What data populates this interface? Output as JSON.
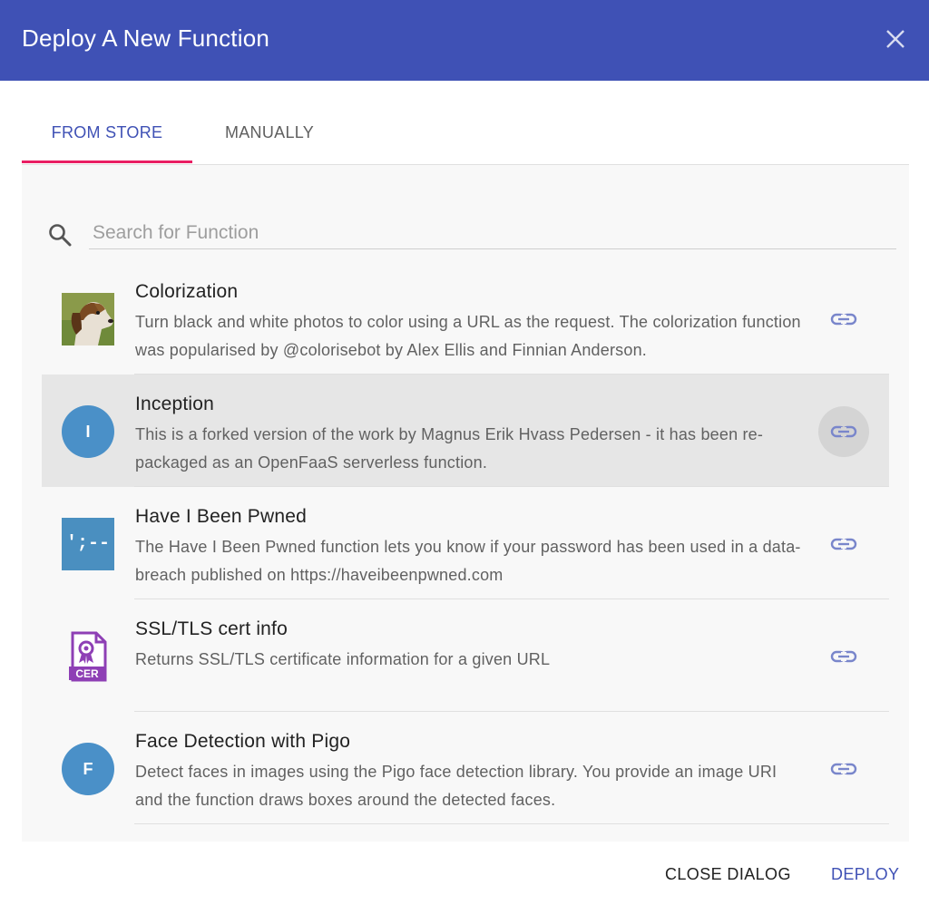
{
  "dialog": {
    "title": "Deploy A New Function",
    "close_icon": "close-icon"
  },
  "tabs": [
    {
      "label": "FROM STORE",
      "active": true
    },
    {
      "label": "MANUALLY",
      "active": false
    }
  ],
  "search": {
    "placeholder": "Search for Function",
    "value": "",
    "icon": "search-icon"
  },
  "functions": [
    {
      "name": "Colorization",
      "description": "Turn black and white photos to color using a URL as the request. The colorization function was popularised by @colorisebot by Alex Ellis and Finnian Anderson.",
      "icon": "dog-photo-icon",
      "link_icon": "link-icon"
    },
    {
      "name": "Inception",
      "description": "This is a forked version of the work by Magnus Erik Hvass Pedersen - it has been re-packaged as an OpenFaaS serverless function.",
      "icon": "letter-avatar",
      "avatar_letter": "I",
      "link_icon": "link-icon",
      "hovered": true
    },
    {
      "name": "Have I Been Pwned",
      "description": "The Have I Been Pwned function lets you know if your password has been used in a data-breach published on https://haveibeenpwned.com",
      "icon": "pwned-logo-icon",
      "logo_text": "';--",
      "link_icon": "link-icon"
    },
    {
      "name": "SSL/TLS cert info",
      "description": "Returns SSL/TLS certificate information for a given URL",
      "icon": "certificate-file-icon",
      "icon_text": "CER",
      "link_icon": "link-icon"
    },
    {
      "name": "Face Detection with Pigo",
      "description": "Detect faces in images using the Pigo face detection library. You provide an image URI and the function draws boxes around the detected faces.",
      "icon": "letter-avatar",
      "avatar_letter": "F",
      "link_icon": "link-icon"
    }
  ],
  "actions": {
    "close_label": "CLOSE DIALOG",
    "deploy_label": "DEPLOY"
  },
  "colors": {
    "header": "#3f51b5",
    "accent": "#3f51b5",
    "tab_ink": "#e91e63",
    "avatar": "#4a90c8",
    "cert_icon": "#8e3fb5"
  }
}
